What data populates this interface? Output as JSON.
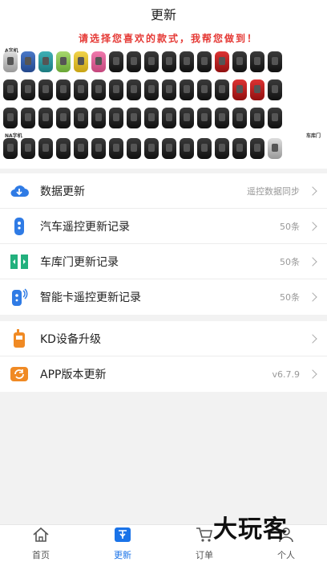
{
  "header": {
    "title": "更新"
  },
  "banner": {
    "headline": "请选择您喜欢的款式，我帮您做到！",
    "group_a": "A字机",
    "group_na": "NA字机",
    "group_garage": "车库门"
  },
  "list_primary": [
    {
      "label": "数据更新",
      "value": "遥控数据同步",
      "icon": "cloud-icon"
    },
    {
      "label": "汽车遥控更新记录",
      "value": "50条",
      "icon": "car-remote-icon"
    },
    {
      "label": "车库门更新记录",
      "value": "50条",
      "icon": "garage-door-icon"
    },
    {
      "label": "智能卡遥控更新记录",
      "value": "50条",
      "icon": "smart-card-icon"
    }
  ],
  "list_secondary": [
    {
      "label": "KD设备升级",
      "value": "",
      "icon": "kd-device-icon"
    },
    {
      "label": "APP版本更新",
      "value": "v6.7.9",
      "icon": "app-update-icon"
    }
  ],
  "tabbar": [
    {
      "label": "首页",
      "icon": "home-icon"
    },
    {
      "label": "更新",
      "icon": "update-icon"
    },
    {
      "label": "订单",
      "icon": "cart-icon"
    },
    {
      "label": "个人",
      "icon": "user-icon"
    }
  ],
  "watermark": "大玩客",
  "colors": {
    "accent": "#1a73e8",
    "banner_text": "#e53935"
  }
}
